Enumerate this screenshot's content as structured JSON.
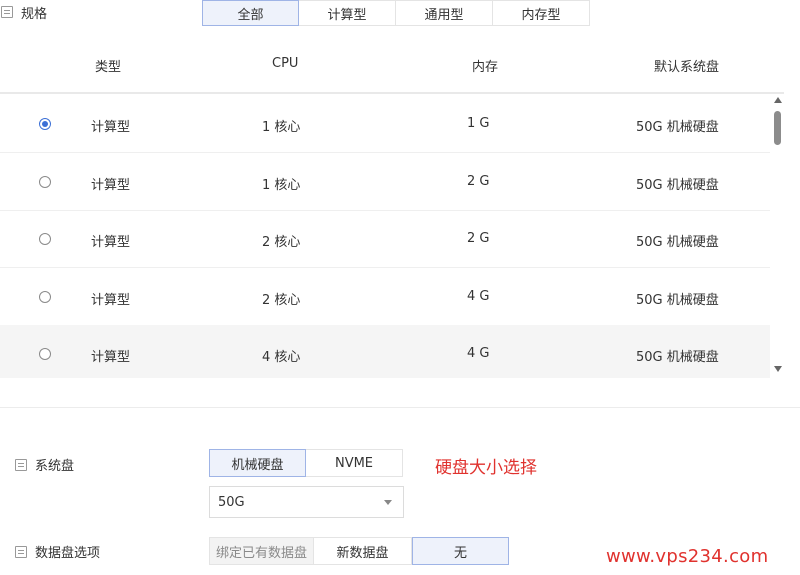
{
  "spec": {
    "label": "规格",
    "tabs": [
      "全部",
      "计算型",
      "通用型",
      "内存型"
    ],
    "active_tab": "全部"
  },
  "table": {
    "columns": [
      "类型",
      "CPU",
      "内存",
      "默认系统盘"
    ],
    "rows": [
      {
        "type": "计算型",
        "cpu": "1 核心",
        "mem": "1 G",
        "disk": "50G 机械硬盘",
        "selected": true
      },
      {
        "type": "计算型",
        "cpu": "1 核心",
        "mem": "2 G",
        "disk": "50G 机械硬盘",
        "selected": false
      },
      {
        "type": "计算型",
        "cpu": "2 核心",
        "mem": "2 G",
        "disk": "50G 机械硬盘",
        "selected": false
      },
      {
        "type": "计算型",
        "cpu": "2 核心",
        "mem": "4 G",
        "disk": "50G 机械硬盘",
        "selected": false
      },
      {
        "type": "计算型",
        "cpu": "4 核心",
        "mem": "4 G",
        "disk": "50G 机械硬盘",
        "selected": false
      }
    ]
  },
  "system_disk": {
    "label": "系统盘",
    "tabs": [
      "机械硬盘",
      "NVME"
    ],
    "active_tab": "机械硬盘",
    "size": "50G",
    "annotation": "硬盘大小选择"
  },
  "data_disk": {
    "label": "数据盘选项",
    "options": [
      "绑定已有数据盘",
      "新数据盘",
      "无"
    ],
    "active_option": "无"
  },
  "watermark": "www.vps234.com",
  "colors": {
    "accent": "#3b6fd6",
    "active_tab_bg": "#eef2fb",
    "annotation": "#e0322e"
  }
}
